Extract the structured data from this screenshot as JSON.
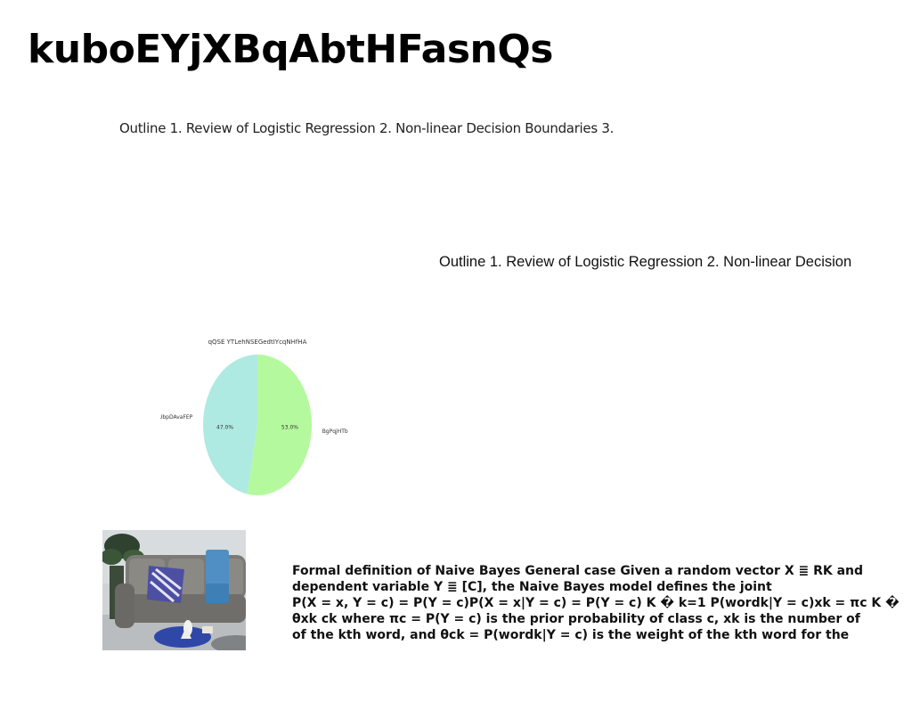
{
  "title": "kuboEYjXBqAbtHFasnQs",
  "text_line_1": "Outline 1. Review of Logistic Regression 2. Non-linear Decision Boundaries 3.",
  "text_line_2": "Outline 1. Review of Logistic Regression 2. Non-linear Decision",
  "chart_data": {
    "type": "pie",
    "title": "qQSE YTLehNSEGedtIYcqNHfHA",
    "labels": [
      "UbpDAvaFEP",
      "BgPqjHTb"
    ],
    "values": [
      47.0,
      53.0
    ],
    "value_labels": [
      "47.0%",
      "53.0%"
    ],
    "colors": [
      "#aeeae2",
      "#b4f99e"
    ]
  },
  "photo": {
    "description_icon": "living-room-photo"
  },
  "paragraph_lines": [
    "Formal definition of Naive Bayes General case Given a random vector X ≣ RK and",
    "dependent variable Y ≣ [C], the Naive Bayes model defines the joint",
    "P(X = x, Y = c) = P(Y = c)P(X = x|Y = c) = P(Y = c) K � k=1 P(wordk|Y = c)xk = πc K �",
    "θxk ck where πc = P(Y = c) is the prior probability of class c, xk is the number of",
    "of the kth word, and θck = P(wordk|Y = c) is the weight of the kth word for the"
  ]
}
